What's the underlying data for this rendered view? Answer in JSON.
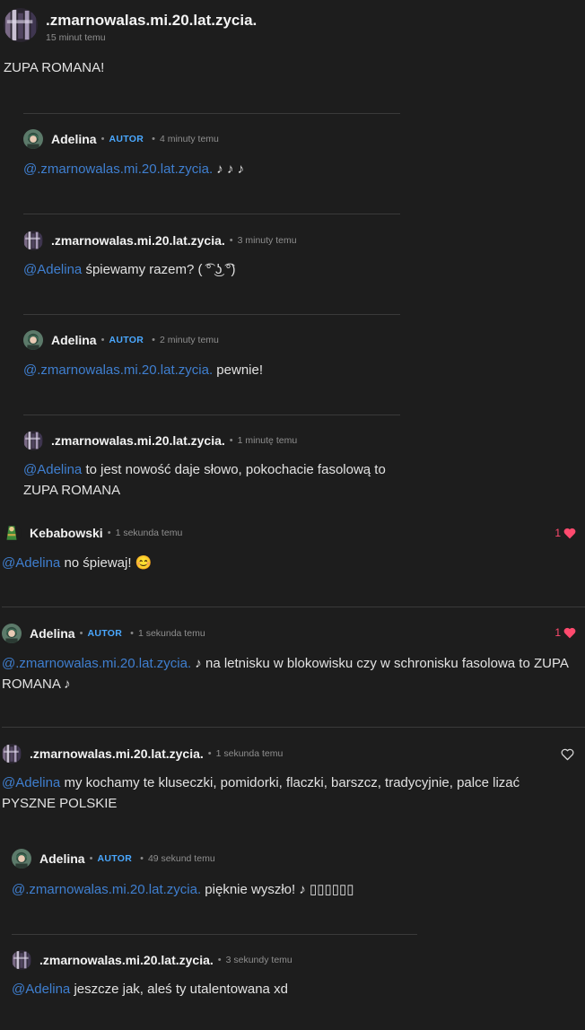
{
  "post": {
    "author": ".zmarnowalas.mi.20.lat.zycia.",
    "time": "15 minut temu",
    "text": "ZUPA ROMANA!"
  },
  "replies": [
    {
      "author": "Adelina",
      "badge": "AUTOR",
      "time": "4 minuty temu",
      "mention": "@.zmarnowalas.mi.20.lat.zycia.",
      "text": " ♪ ♪ ♪"
    },
    {
      "author": ".zmarnowalas.mi.20.lat.zycia.",
      "time": "3 minuty temu",
      "mention": "@Adelina",
      "text": " śpiewamy razem? ( ͡° ͜ʖ ͡°)"
    },
    {
      "author": "Adelina",
      "badge": "AUTOR",
      "time": "2 minuty temu",
      "mention": "@.zmarnowalas.mi.20.lat.zycia.",
      "text": " pewnie!"
    },
    {
      "author": ".zmarnowalas.mi.20.lat.zycia.",
      "time": "1 minutę temu",
      "mention": "@Adelina",
      "text": " to jest nowość daje słowo, pokochacie fasolową to ZUPA ROMANA"
    }
  ],
  "comments": [
    {
      "author": "Kebabowski",
      "time": "1 sekunda temu",
      "mention": "@Adelina",
      "text": " no śpiewaj! 😊",
      "likes": "1"
    },
    {
      "author": "Adelina",
      "badge": "AUTOR",
      "time": "1 sekunda temu",
      "mention": "@.zmarnowalas.mi.20.lat.zycia.",
      "text": " ♪  na letnisku w blokowisku czy w schronisku fasolowa to ZUPA ROMANA ♪",
      "likes": "1"
    },
    {
      "author": ".zmarnowalas.mi.20.lat.zycia.",
      "time": "1 sekunda temu",
      "mention": "@Adelina",
      "text": " my kochamy te kluseczki, pomidorki, flaczki, barszcz, tradycyjnie, palce lizać PYSZNE POLSKIE"
    }
  ],
  "nested": [
    {
      "author": "Adelina",
      "badge": "AUTOR",
      "time": "49 sekund temu",
      "mention": "@.zmarnowalas.mi.20.lat.zycia.",
      "text": " pięknie wyszło! ♪ ▯▯▯▯▯▯"
    },
    {
      "author": ".zmarnowalas.mi.20.lat.zycia.",
      "time": "3 sekundy temu",
      "mention": "@Adelina",
      "text": " jeszcze jak, aleś ty utalentowana xd"
    }
  ],
  "colors": {
    "background": "#1d1d1d",
    "mention": "#3f7fd0",
    "badge": "#4aa8ff",
    "heart": "#ff4a6e"
  },
  "icons": {
    "avatar_zmarnowalas": "dark-collage-avatar",
    "avatar_adelina": "green-haired-girl-avatar",
    "avatar_kebabowski": "green-figure-avatar",
    "like": "heart-icon"
  }
}
